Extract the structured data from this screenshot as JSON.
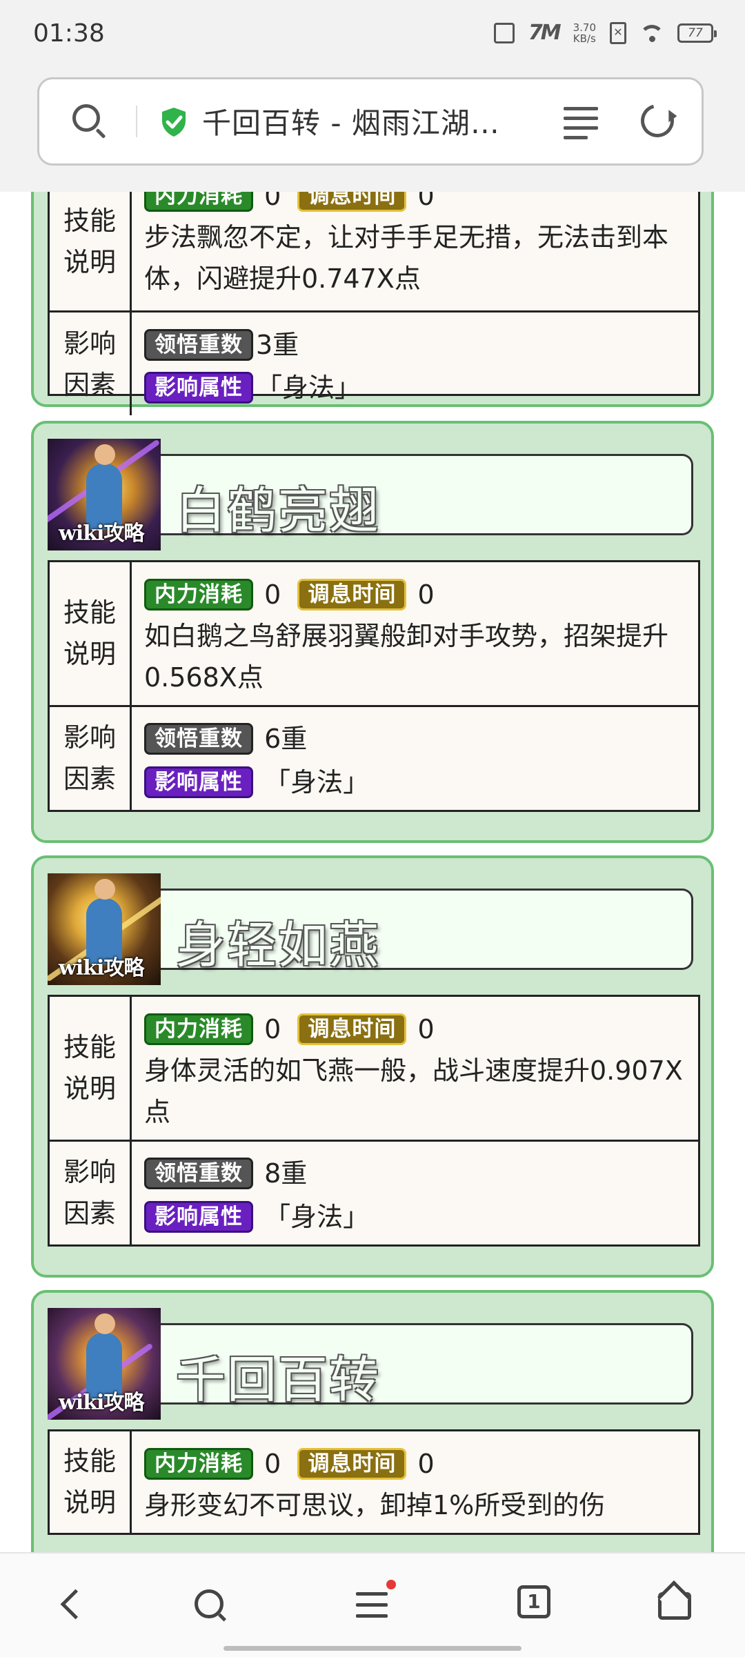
{
  "status_bar": {
    "time": "01:38",
    "signal": "7M",
    "speed": "3.70",
    "speed_unit": "KB/s",
    "battery": "77"
  },
  "address_bar": {
    "title": "千回百转 - 烟雨江湖…",
    "secure_color": "#2fb34a"
  },
  "labels": {
    "skill_desc": [
      "技能",
      "说明"
    ],
    "factors": [
      "影响",
      "因素"
    ]
  },
  "tags": {
    "mp_cost": "内力消耗",
    "cooldown": "调息时间",
    "enlighten": "领悟重数",
    "attribute": "影响属性"
  },
  "cards": [
    {
      "title": "",
      "mp_cost": "0",
      "cooldown": "0",
      "description": "步法飘忽不定，让对手手足无措，无法击到本体，闪避提升0.747X点",
      "enlighten": "3重",
      "attribute": "「身法」"
    },
    {
      "title": "白鹤亮翅",
      "avatar_watermark": "wiki攻略",
      "mp_cost": "0",
      "cooldown": "0",
      "description": "如白鹅之鸟舒展羽翼般卸对手攻势，招架提升0.568X点",
      "enlighten": "6重",
      "attribute": "「身法」"
    },
    {
      "title": "身轻如燕",
      "avatar_watermark": "wiki攻略",
      "mp_cost": "0",
      "cooldown": "0",
      "description": "身体灵活的如飞燕一般，战斗速度提升0.907X点",
      "enlighten": "8重",
      "attribute": "「身法」"
    },
    {
      "title": "千回百转",
      "avatar_watermark": "wiki攻略",
      "mp_cost": "0",
      "cooldown": "0",
      "description": "身形变幻不可思议，卸掉1%所受到的伤"
    }
  ],
  "bottom_nav": {
    "tab_count": "1",
    "menu_badge_color": "#e53935"
  }
}
